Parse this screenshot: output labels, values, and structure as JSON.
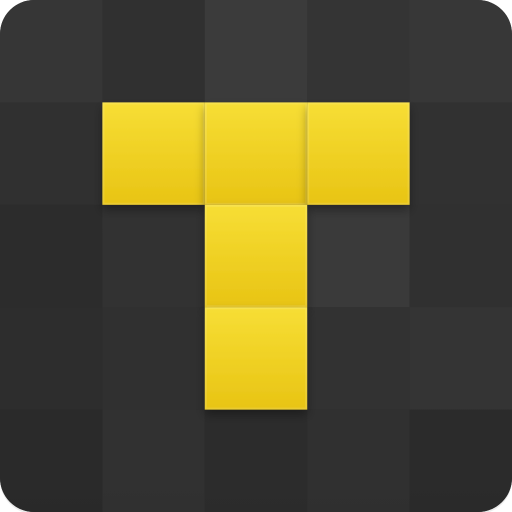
{
  "icon": {
    "name": "tetromino-t-app-icon",
    "background_color": "#3a3a3a",
    "accent_color": "#f2d21f",
    "accent_color_shade": "#d9b80f",
    "grid": {
      "cols": 5,
      "rows": 5,
      "tiles": [
        {
          "r": 0,
          "c": 0,
          "fill": "#3a3a3a"
        },
        {
          "r": 0,
          "c": 1,
          "fill": "#343434"
        },
        {
          "r": 0,
          "c": 2,
          "fill": "#3f3f3f"
        },
        {
          "r": 0,
          "c": 3,
          "fill": "#383838"
        },
        {
          "r": 0,
          "c": 4,
          "fill": "#3b3b3b"
        },
        {
          "r": 1,
          "c": 0,
          "fill": "#333333"
        },
        {
          "r": 1,
          "c": 1,
          "fill": "#f2d21f"
        },
        {
          "r": 1,
          "c": 2,
          "fill": "#f0cf1c"
        },
        {
          "r": 1,
          "c": 3,
          "fill": "#f2d21f"
        },
        {
          "r": 1,
          "c": 4,
          "fill": "#353535"
        },
        {
          "r": 2,
          "c": 0,
          "fill": "#2f2f2f"
        },
        {
          "r": 2,
          "c": 1,
          "fill": "#363636"
        },
        {
          "r": 2,
          "c": 2,
          "fill": "#f2d21f"
        },
        {
          "r": 2,
          "c": 3,
          "fill": "#3e3e3e"
        },
        {
          "r": 2,
          "c": 4,
          "fill": "#333333"
        },
        {
          "r": 3,
          "c": 0,
          "fill": "#303030"
        },
        {
          "r": 3,
          "c": 1,
          "fill": "#343434"
        },
        {
          "r": 3,
          "c": 2,
          "fill": "#f2d21f"
        },
        {
          "r": 3,
          "c": 3,
          "fill": "#363636"
        },
        {
          "r": 3,
          "c": 4,
          "fill": "#383838"
        },
        {
          "r": 4,
          "c": 0,
          "fill": "#2d2d2d"
        },
        {
          "r": 4,
          "c": 1,
          "fill": "#353535"
        },
        {
          "r": 4,
          "c": 2,
          "fill": "#2f2f2f"
        },
        {
          "r": 4,
          "c": 3,
          "fill": "#333333"
        },
        {
          "r": 4,
          "c": 4,
          "fill": "#2e2e2e"
        }
      ]
    }
  }
}
